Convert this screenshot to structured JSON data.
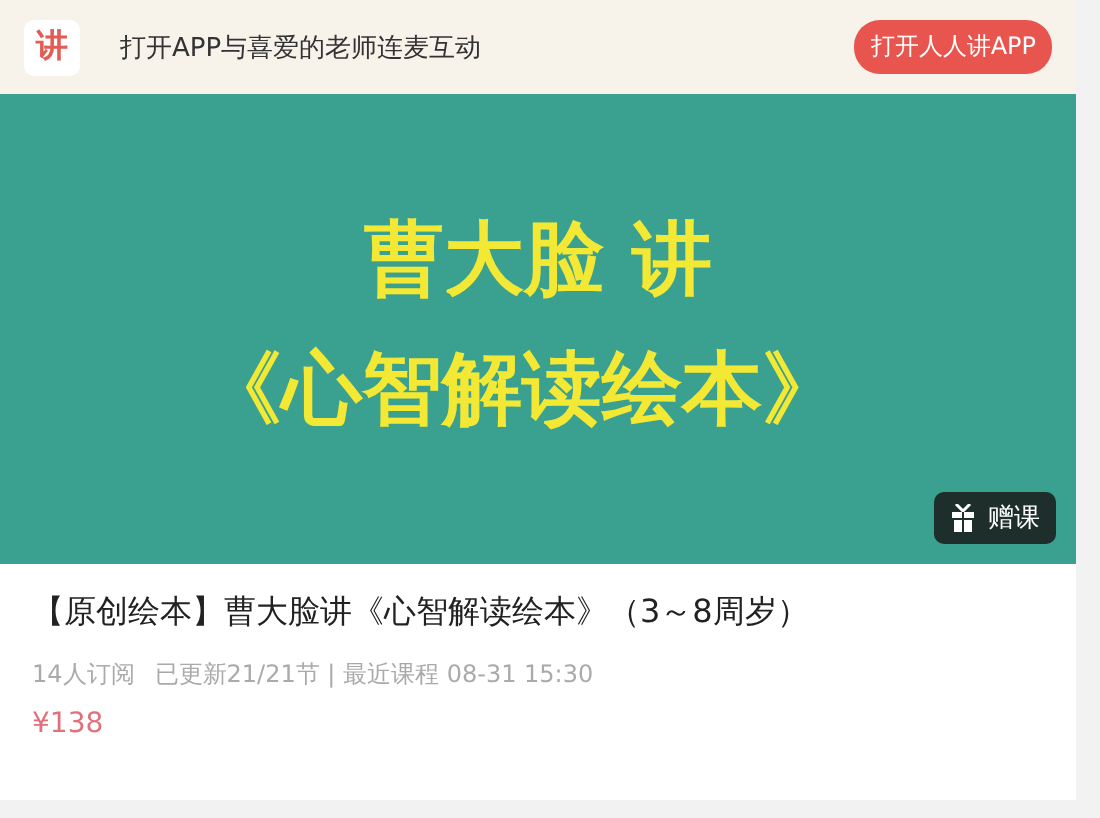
{
  "app_bar": {
    "logo": "讲",
    "message": "打开APP与喜爱的老师连麦互动",
    "open_button": "打开人人讲APP"
  },
  "cover": {
    "line_1": "曹大脸 讲",
    "line_2": "《心智解读绘本》",
    "gift_button": "赠课"
  },
  "course": {
    "title": "【原创绘本】曹大脸讲《心智解读绘本》（3～8周岁）",
    "subscribers": "14人订阅",
    "progress": "已更新21/21节 | 最近课程 08-31 15:30",
    "price": "¥138"
  }
}
